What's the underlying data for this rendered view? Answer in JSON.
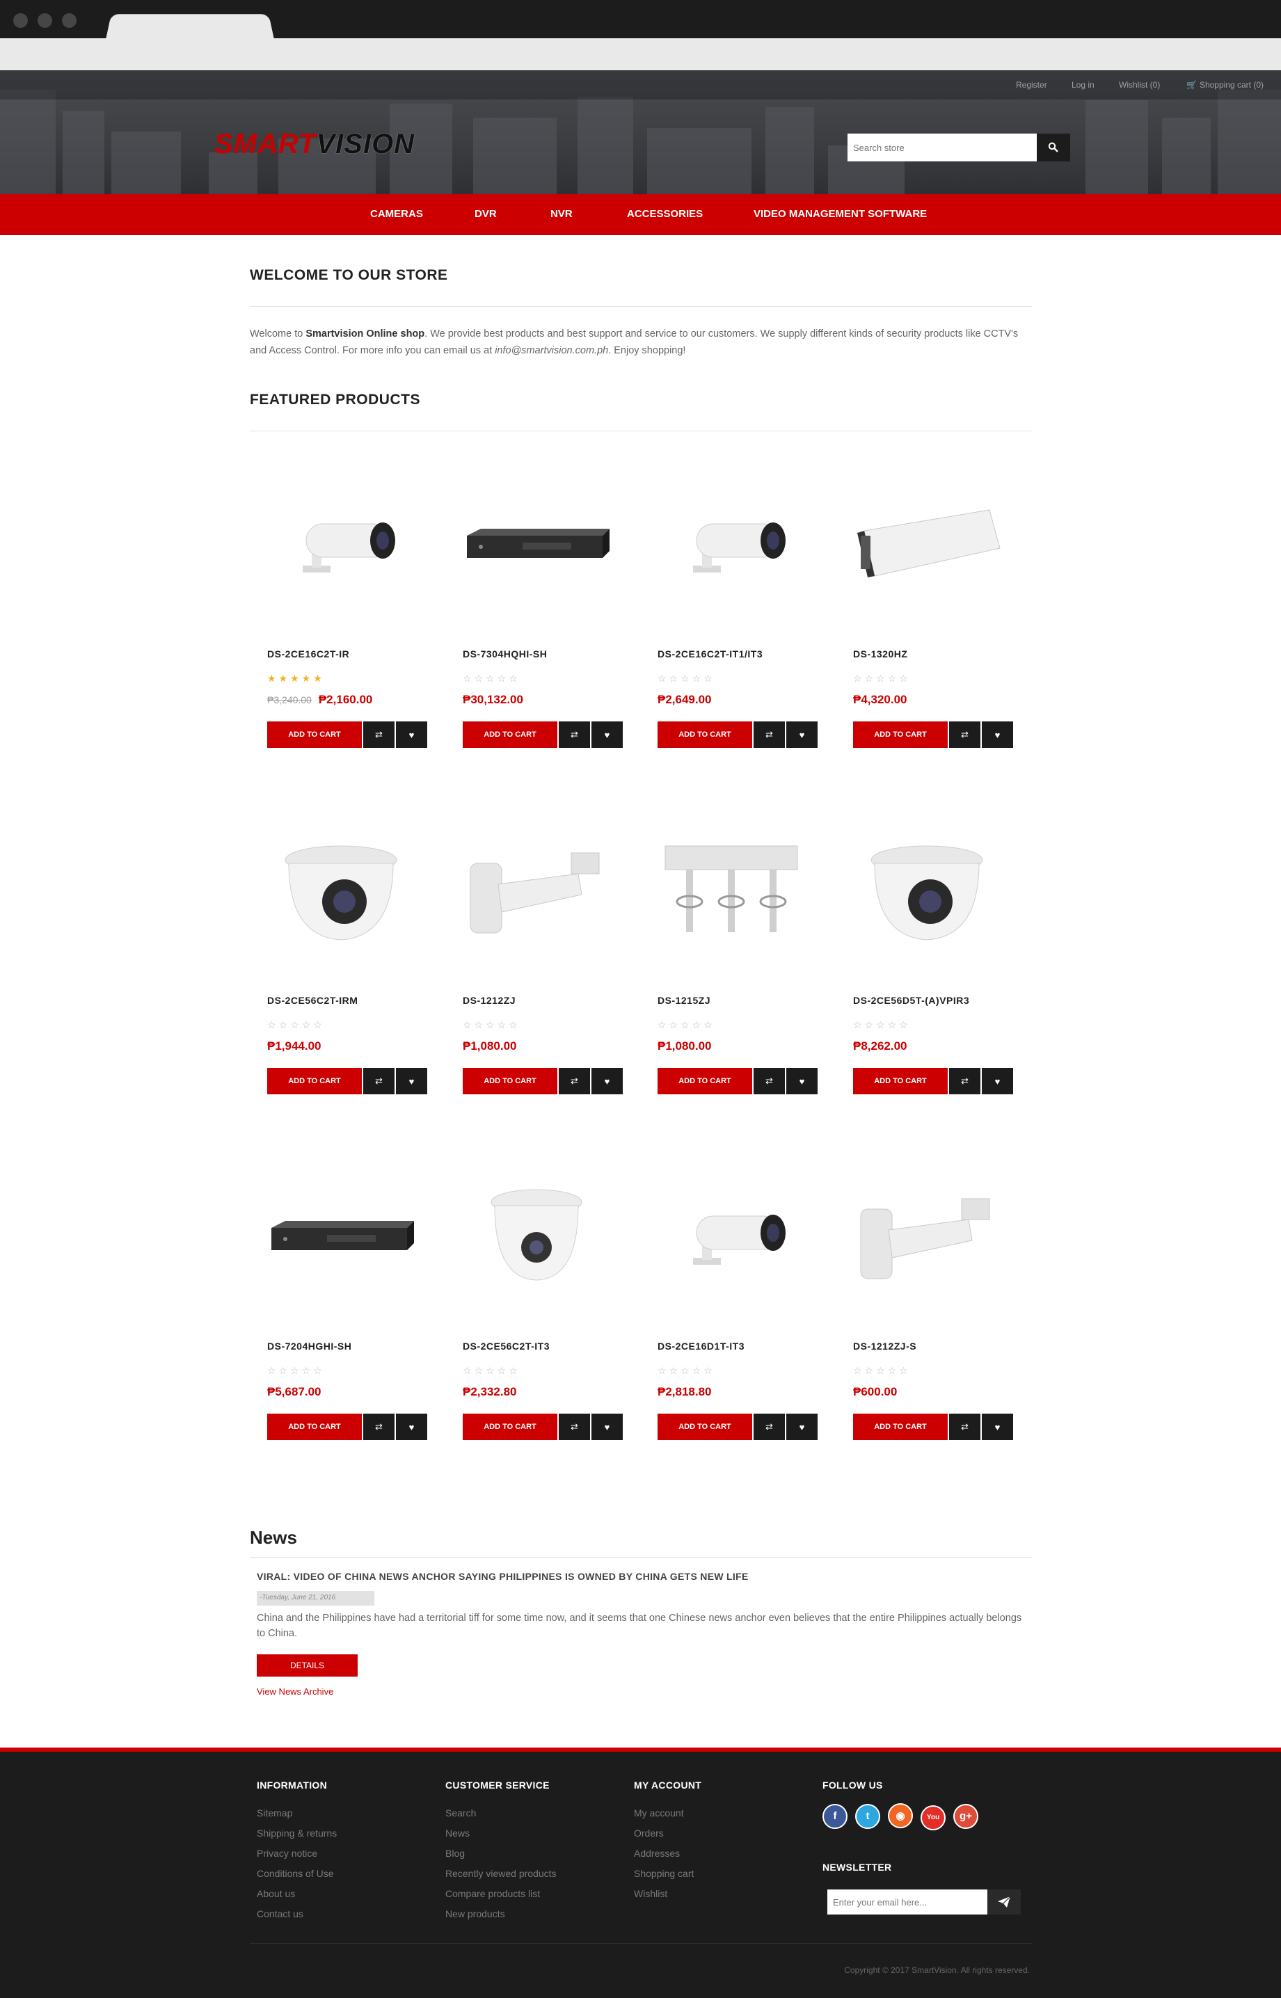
{
  "header": {
    "top_links": [
      {
        "label": "Register"
      },
      {
        "label": "Log in"
      },
      {
        "label": "Wishlist (0)"
      },
      {
        "label": "Shopping cart (0)"
      }
    ],
    "logo_part1": "SMART",
    "logo_part2": "VISION",
    "search_placeholder": "Search store"
  },
  "nav": [
    "CAMERAS",
    "DVR",
    "NVR",
    "ACCESSORIES",
    "VIDEO MANAGEMENT SOFTWARE"
  ],
  "welcome": {
    "title": "WELCOME TO OUR STORE",
    "text_1": "Welcome to ",
    "brand": "Smartvision  Online shop",
    "text_2": ". We provide best products and best support and service to our customers. We supply different kinds of security products like CCTV's and Access Control.  For more info you can email us at ",
    "email": "info@smartvision.com.ph",
    "text_3": ". Enjoy shopping!"
  },
  "featured": {
    "title": "FEATURED PRODUCTS",
    "add_to_cart": "ADD TO CART",
    "products": [
      {
        "name": "DS-2CE16C2T-IR",
        "old_price": "₱3,240.00",
        "price": "₱2,160.00",
        "rating": 5,
        "icon": "bullet-camera-icon"
      },
      {
        "name": "DS-7304HQHI-SH",
        "old_price": "",
        "price": "₱30,132.00",
        "rating": 0,
        "icon": "dvr-recorder-icon"
      },
      {
        "name": "DS-2CE16C2T-IT1/IT3",
        "old_price": "",
        "price": "₱2,649.00",
        "rating": 0,
        "icon": "bullet-camera-icon"
      },
      {
        "name": "DS-1320HZ",
        "old_price": "",
        "price": "₱4,320.00",
        "rating": 0,
        "icon": "camera-housing-icon"
      },
      {
        "name": "DS-2CE56C2T-IRM",
        "old_price": "",
        "price": "₱1,944.00",
        "rating": 0,
        "icon": "dome-camera-icon"
      },
      {
        "name": "DS-1212ZJ",
        "old_price": "",
        "price": "₱1,080.00",
        "rating": 0,
        "icon": "wall-bracket-icon"
      },
      {
        "name": "DS-1215ZJ",
        "old_price": "",
        "price": "₱1,080.00",
        "rating": 0,
        "icon": "pole-mount-icon"
      },
      {
        "name": "DS-2CE56D5T-(A)VPIR3",
        "old_price": "",
        "price": "₱8,262.00",
        "rating": 0,
        "icon": "dome-camera-icon"
      },
      {
        "name": "DS-7204HGHI-SH",
        "old_price": "",
        "price": "₱5,687.00",
        "rating": 0,
        "icon": "dvr-recorder-icon"
      },
      {
        "name": "DS-2CE56C2T-IT3",
        "old_price": "",
        "price": "₱2,332.80",
        "rating": 0,
        "icon": "turret-camera-icon"
      },
      {
        "name": "DS-2CE16D1T-IT3",
        "old_price": "",
        "price": "₱2,818.80",
        "rating": 0,
        "icon": "bullet-camera-icon"
      },
      {
        "name": "DS-1212ZJ-S",
        "old_price": "",
        "price": "₱600.00",
        "rating": 0,
        "icon": "wall-bracket-icon"
      }
    ]
  },
  "news": {
    "title": "News",
    "item_title": "VIRAL: VIDEO OF CHINA NEWS ANCHOR SAYING PHILIPPINES IS OWNED BY CHINA GETS NEW LIFE",
    "date": "-Tuesday, June 21, 2016",
    "body": "China and the Philippines have had a territorial tiff for some time now, and it seems that one Chinese news anchor even believes that the entire Philippines actually belongs to China.",
    "details": "DETAILS",
    "archive": "View News Archive"
  },
  "footer": {
    "information": {
      "title": "INFORMATION",
      "links": [
        "Sitemap",
        "Shipping & returns",
        "Privacy notice",
        "Conditions of Use",
        "About us",
        "Contact us"
      ]
    },
    "customer_service": {
      "title": "CUSTOMER SERVICE",
      "links": [
        "Search",
        "News",
        "Blog",
        "Recently viewed products",
        "Compare products list",
        "New products"
      ]
    },
    "my_account": {
      "title": "MY ACCOUNT",
      "links": [
        "My account",
        "Orders",
        "Addresses",
        "Shopping cart",
        "Wishlist"
      ]
    },
    "follow_us": "FOLLOW US",
    "social": [
      {
        "name": "facebook-icon",
        "glyph": "f",
        "color": "#3b5998"
      },
      {
        "name": "twitter-icon",
        "glyph": "t",
        "color": "#2ca7e0"
      },
      {
        "name": "rss-icon",
        "glyph": "◉",
        "color": "#f26522"
      },
      {
        "name": "youtube-icon",
        "glyph": "You",
        "color": "#e52d27"
      },
      {
        "name": "google-plus-icon",
        "glyph": "g+",
        "color": "#dd4b39"
      }
    ],
    "newsletter": "NEWSLETTER",
    "newsletter_placeholder": "Enter your email here...",
    "copyright": "Copyright © 2017 SmartVision. All rights reserved."
  },
  "colors": {
    "accent": "#cc0000",
    "dark": "#1c1c1c"
  }
}
